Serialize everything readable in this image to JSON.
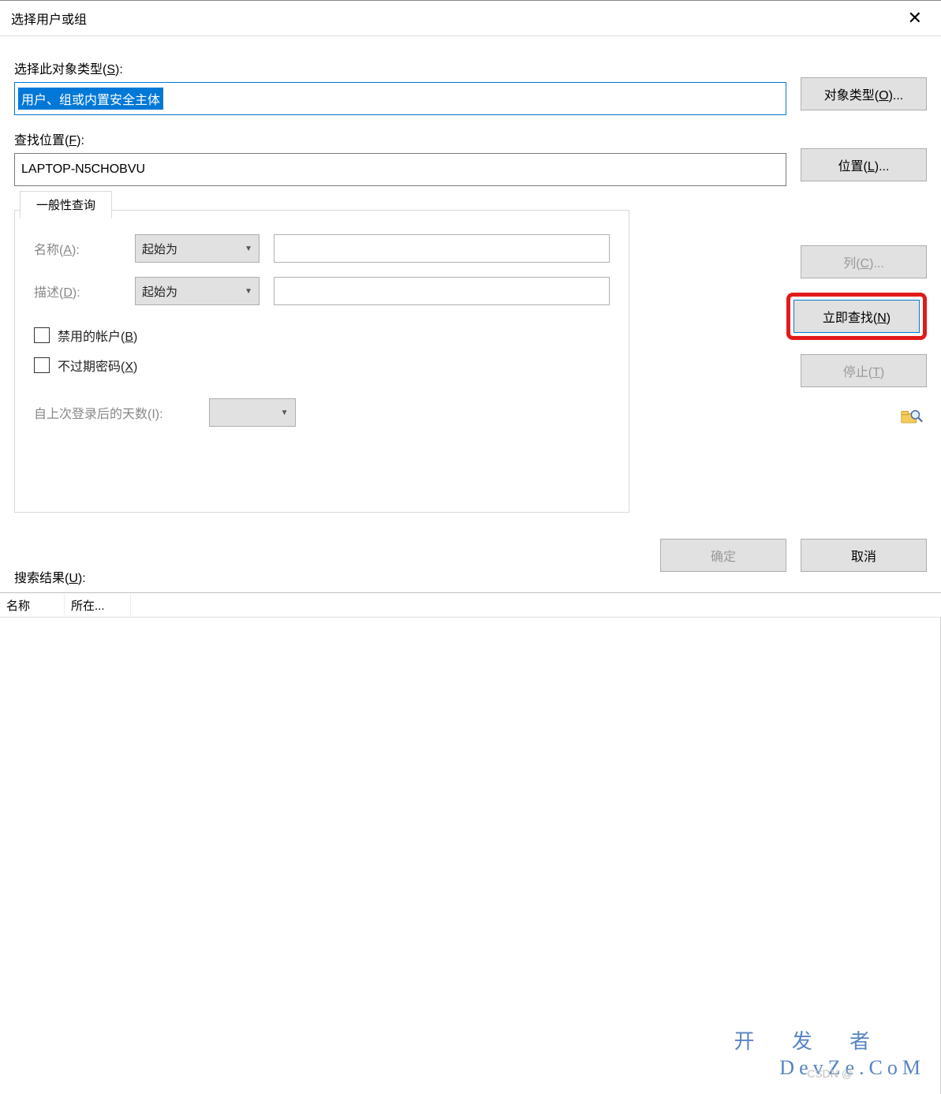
{
  "dialog": {
    "title": "选择用户或组",
    "close": "✕"
  },
  "objectType": {
    "label_pre": "选择此对象类型(",
    "label_key": "S",
    "label_post": "):",
    "value": "用户、组或内置安全主体",
    "button_pre": "对象类型(",
    "button_key": "O",
    "button_post": ")..."
  },
  "location": {
    "label_pre": "查找位置(",
    "label_key": "F",
    "label_post": "):",
    "value": "LAPTOP-N5CHOBVU",
    "button_pre": "位置(",
    "button_key": "L",
    "button_post": ")..."
  },
  "tabs": {
    "general": "一般性查询"
  },
  "query": {
    "name_label_pre": "名称(",
    "name_label_key": "A",
    "name_label_post": "):",
    "name_combo": "起始为",
    "name_input": "",
    "desc_label_pre": "描述(",
    "desc_label_key": "D",
    "desc_label_post": "):",
    "desc_combo": "起始为",
    "desc_input": "",
    "disabled_pre": "禁用的帐户(",
    "disabled_key": "B",
    "disabled_post": ")",
    "noexpire_pre": "不过期密码(",
    "noexpire_key": "X",
    "noexpire_post": ")",
    "days_label": "自上次登录后的天数(I):"
  },
  "sidebuttons": {
    "columns_pre": "列(",
    "columns_key": "C",
    "columns_post": ")...",
    "findnow_pre": "立即查找(",
    "findnow_key": "N",
    "findnow_post": ")",
    "stop_pre": "停止(",
    "stop_key": "T",
    "stop_post": ")"
  },
  "footer": {
    "ok": "确定",
    "cancel": "取消"
  },
  "results": {
    "label_pre": "搜索结果(",
    "label_key": "U",
    "label_post": "):",
    "col_name": "名称",
    "col_loc": "所在..."
  },
  "watermark": {
    "line1": "开 发 者",
    "line2": "DevZe.CoM",
    "csdn": "CSDN @"
  }
}
